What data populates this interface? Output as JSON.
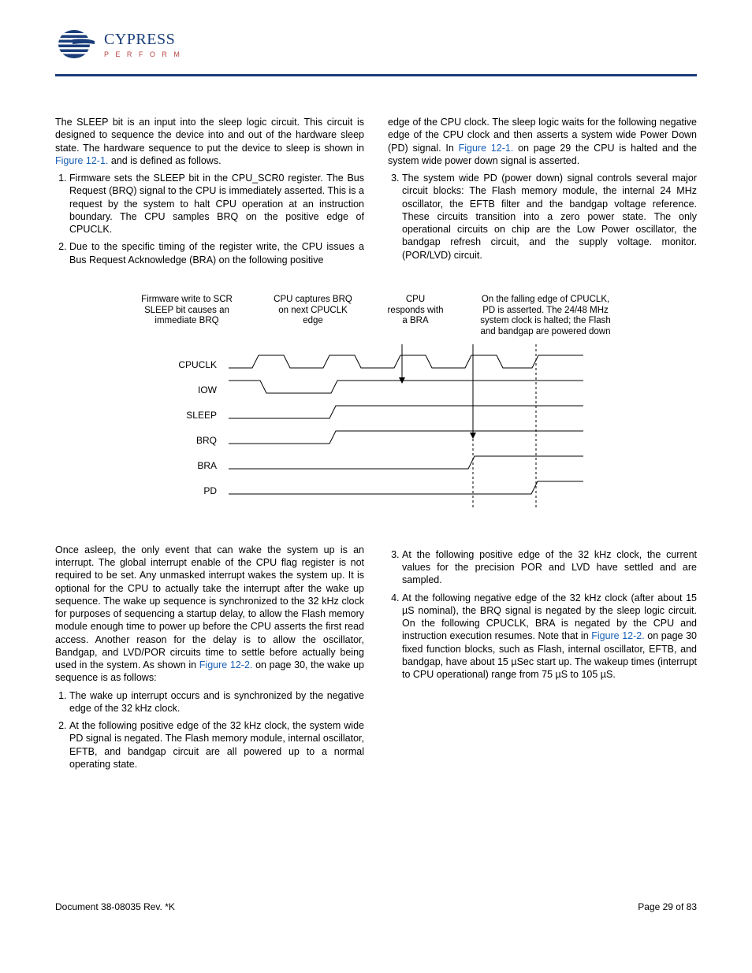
{
  "logo": {
    "brand": "CYPRESS",
    "tagline": "P E R F O R M"
  },
  "intro": {
    "p1": "The SLEEP bit is an input into the sleep logic circuit. This circuit is designed to sequence the device into and out of the hardware sleep state. The hardware sequence to put the device to sleep is shown in ",
    "link1": "Figure 12-1.",
    "p1_tail": " and is defined as follows.",
    "li1": "Firmware sets the SLEEP bit in the CPU_SCR0 register. The Bus Request (BRQ) signal to the CPU is immediately asserted. This is a request by the system to halt CPU operation at an instruction boundary. The CPU samples BRQ on the positive edge of CPUCLK.",
    "li2_a": "Due to the specific timing of the register write, the CPU issues a Bus Request Acknowledge (BRA) on the following positive",
    "li2_b": "edge of the CPU clock. The sleep logic waits for the following negative edge of the CPU clock and then asserts a system wide Power Down (PD) signal. In ",
    "li2_link": "Figure 12-1.",
    "li2_tail": " on page 29 the CPU is halted and the system wide power down signal is asserted.",
    "li3": "The system wide PD (power down) signal controls several major circuit blocks: The Flash memory module, the internal 24 MHz oscillator, the EFTB filter and the bandgap voltage reference. These circuits transition into a zero power state. The only operational circuits on chip are the Low Power oscillator, the bandgap refresh circuit, and the supply voltage. monitor. (POR/LVD) circuit."
  },
  "diagram": {
    "lbl1": "Firmware write to SCR\nSLEEP bit causes an\nimmediate BRQ",
    "lbl2": "CPU captures BRQ\non next CPUCLK\nedge",
    "lbl3": "CPU\nresponds with\na BRA",
    "lbl4": "On the falling edge of CPUCLK,\nPD is asserted. The 24/48 MHz\nsystem clock is halted; the Flash\nand bandgap are powered down",
    "signals": [
      "CPUCLK",
      "IOW",
      "SLEEP",
      "BRQ",
      "BRA",
      "PD"
    ]
  },
  "wake": {
    "p1_a": "Once asleep, the only event that can wake the system up is an interrupt. The global interrupt enable of the CPU flag register is not required to be set. Any unmasked interrupt wakes the system up. It is optional for the CPU to actually take the interrupt after the wake up sequence. The wake up sequence is synchronized to the 32 kHz clock for purposes of sequencing a startup delay, to allow the Flash memory module enough time to power up before the CPU asserts the first read access. Another reason for the delay is to allow the oscillator, Bandgap, and LVD/POR circuits time to settle before actually being used in the system. As shown in ",
    "p1_link": "Figure 12-2.",
    "p1_tail": " on page 30, the wake up sequence is as follows:",
    "li1": "The wake up interrupt occurs and is synchronized by the negative edge of the 32 kHz clock.",
    "li2": "At the following positive edge of the 32 kHz clock, the system wide PD signal is negated. The Flash memory module, internal oscillator, EFTB, and bandgap circuit are all powered up to a normal operating state.",
    "li3": "At the following positive edge of the 32 kHz clock, the current values for the precision POR and LVD have settled and are sampled.",
    "li4_a": "At the following negative edge of the 32 kHz clock (after about 15 µS nominal), the BRQ signal is negated by the sleep logic circuit. On the following CPUCLK, BRA is negated by the CPU and instruction execution resumes. Note that in ",
    "li4_link": "Figure 12-2.",
    "li4_tail": " on page 30 fixed function blocks, such as Flash, internal oscillator, EFTB, and bandgap, have about 15 µSec start up. The wakeup times (interrupt to CPU operational) range from 75 µS to 105 µS."
  },
  "footer": {
    "left": "Document 38-08035 Rev. *K",
    "right": "Page 29 of 83"
  }
}
